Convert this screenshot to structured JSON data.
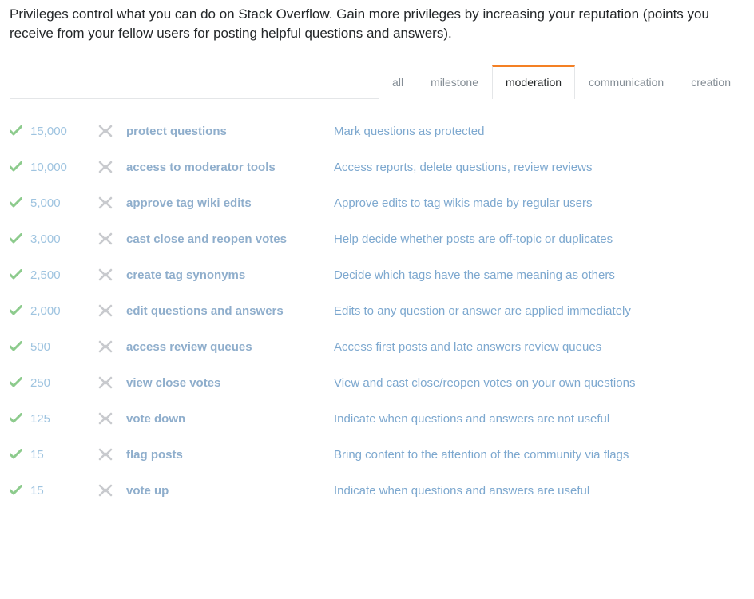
{
  "intro": "Privileges control what you can do on Stack Overflow. Gain more privileges by increasing your reputation (points you receive from your fellow users for posting helpful questions and answers).",
  "tabs": [
    {
      "label": "all",
      "active": false
    },
    {
      "label": "milestone",
      "active": false
    },
    {
      "label": "moderation",
      "active": true
    },
    {
      "label": "communication",
      "active": false
    },
    {
      "label": "creation",
      "active": false
    }
  ],
  "privileges": [
    {
      "rep": "15,000",
      "name": "protect questions",
      "desc": "Mark questions as protected"
    },
    {
      "rep": "10,000",
      "name": "access to moderator tools",
      "desc": "Access reports, delete questions, review reviews"
    },
    {
      "rep": "5,000",
      "name": "approve tag wiki edits",
      "desc": "Approve edits to tag wikis made by regular users"
    },
    {
      "rep": "3,000",
      "name": "cast close and reopen votes",
      "desc": "Help decide whether posts are off-topic or duplicates"
    },
    {
      "rep": "2,500",
      "name": "create tag synonyms",
      "desc": "Decide which tags have the same meaning as others"
    },
    {
      "rep": "2,000",
      "name": "edit questions and answers",
      "desc": "Edits to any question or answer are applied immediately"
    },
    {
      "rep": "500",
      "name": "access review queues",
      "desc": "Access first posts and late answers review queues"
    },
    {
      "rep": "250",
      "name": "view close votes",
      "desc": "View and cast close/reopen votes on your own questions"
    },
    {
      "rep": "125",
      "name": "vote down",
      "desc": "Indicate when questions and answers are not useful"
    },
    {
      "rep": "15",
      "name": "flag posts",
      "desc": "Bring content to the attention of the community via flags"
    },
    {
      "rep": "15",
      "name": "vote up",
      "desc": "Indicate when questions and answers are useful"
    }
  ]
}
